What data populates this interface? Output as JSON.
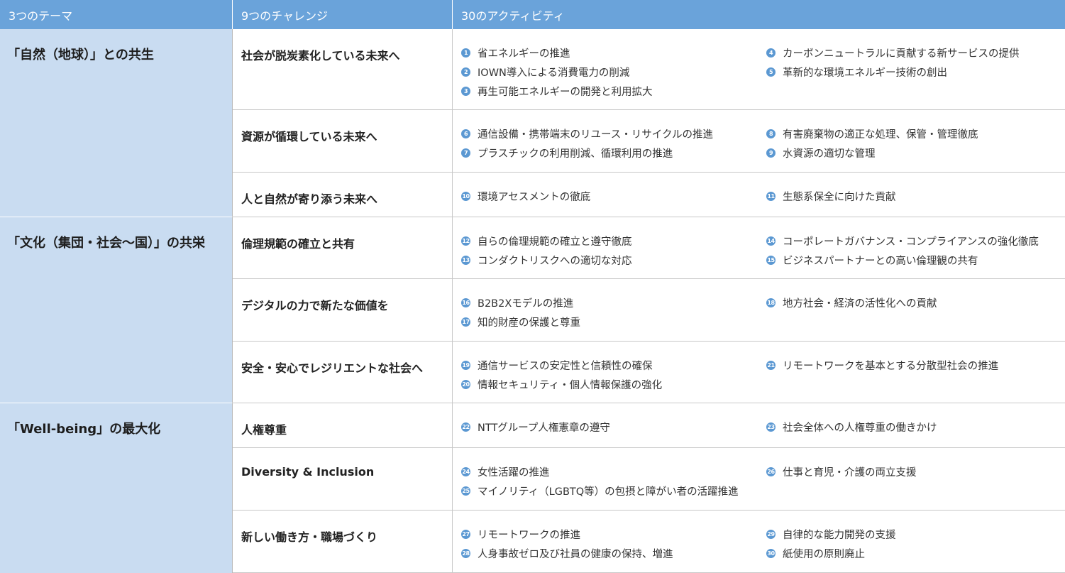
{
  "headers": {
    "themes": "3つのテーマ",
    "challenges": "9つのチャレンジ",
    "activities": "30のアクティビティ"
  },
  "themes": [
    "「自然（地球）」との共生",
    "「文化（集団・社会〜国）」の共栄",
    "「Well-being」の最大化"
  ],
  "rows": [
    {
      "challenge": "社会が脱炭素化している未来へ",
      "left": [
        {
          "num": "1",
          "text": "省エネルギーの推進"
        },
        {
          "num": "2",
          "text": "IOWN導入による消費電力の削減"
        },
        {
          "num": "3",
          "text": "再生可能エネルギーの開発と利用拡大"
        }
      ],
      "right": [
        {
          "num": "4",
          "text": "カーボンニュートラルに貢献する新サービスの提供"
        },
        {
          "num": "5",
          "text": "革新的な環境エネルギー技術の創出"
        }
      ]
    },
    {
      "challenge": "資源が循環している未来へ",
      "left": [
        {
          "num": "6",
          "text": "通信設備・携帯端末のリユース・リサイクルの推進"
        },
        {
          "num": "7",
          "text": "プラスチックの利用削減、循環利用の推進"
        }
      ],
      "right": [
        {
          "num": "8",
          "text": "有害廃棄物の適正な処理、保管・管理徹底"
        },
        {
          "num": "9",
          "text": "水資源の適切な管理"
        }
      ]
    },
    {
      "challenge": "人と自然が寄り添う未来へ",
      "left": [
        {
          "num": "10",
          "text": "環境アセスメントの徹底"
        }
      ],
      "right": [
        {
          "num": "11",
          "text": "生態系保全に向けた貢献"
        }
      ]
    },
    {
      "challenge": "倫理規範の確立と共有",
      "left": [
        {
          "num": "12",
          "text": "自らの倫理規範の確立と遵守徹底"
        },
        {
          "num": "13",
          "text": "コンダクトリスクへの適切な対応"
        }
      ],
      "right": [
        {
          "num": "14",
          "text": "コーポレートガバナンス・コンプライアンスの強化徹底"
        },
        {
          "num": "15",
          "text": "ビジネスパートナーとの高い倫理観の共有"
        }
      ]
    },
    {
      "challenge": "デジタルの力で新たな価値を",
      "left": [
        {
          "num": "16",
          "text": "B2B2Xモデルの推進"
        },
        {
          "num": "17",
          "text": "知的財産の保護と尊重"
        }
      ],
      "right": [
        {
          "num": "18",
          "text": "地方社会・経済の活性化への貢献"
        }
      ]
    },
    {
      "challenge": "安全・安心でレジリエントな社会へ",
      "left": [
        {
          "num": "19",
          "text": "通信サービスの安定性と信頼性の確保"
        },
        {
          "num": "20",
          "text": "情報セキュリティ・個人情報保護の強化"
        }
      ],
      "right": [
        {
          "num": "21",
          "text": "リモートワークを基本とする分散型社会の推進"
        }
      ]
    },
    {
      "challenge": "人権尊重",
      "left": [
        {
          "num": "22",
          "text": "NTTグループ人権憲章の遵守"
        }
      ],
      "right": [
        {
          "num": "23",
          "text": "社会全体への人権尊重の働きかけ"
        }
      ]
    },
    {
      "challenge": "Diversity & Inclusion",
      "left": [
        {
          "num": "24",
          "text": "女性活躍の推進"
        },
        {
          "num": "25",
          "text": "マイノリティ（LGBTQ等）の包摂と障がい者の活躍推進"
        }
      ],
      "right": [
        {
          "num": "26",
          "text": "仕事と育児・介護の両立支援"
        }
      ]
    },
    {
      "challenge": "新しい働き方・職場づくり",
      "left": [
        {
          "num": "27",
          "text": "リモートワークの推進"
        },
        {
          "num": "28",
          "text": "人身事故ゼロ及び社員の健康の保持、増進"
        }
      ],
      "right": [
        {
          "num": "29",
          "text": "自律的な能力開発の支援"
        },
        {
          "num": "30",
          "text": "紙使用の原則廃止"
        }
      ]
    }
  ],
  "colors": {
    "header_bg": "#6aa3da",
    "theme_bg": "#c9dcf1",
    "number_badge": "#5b98d2"
  }
}
